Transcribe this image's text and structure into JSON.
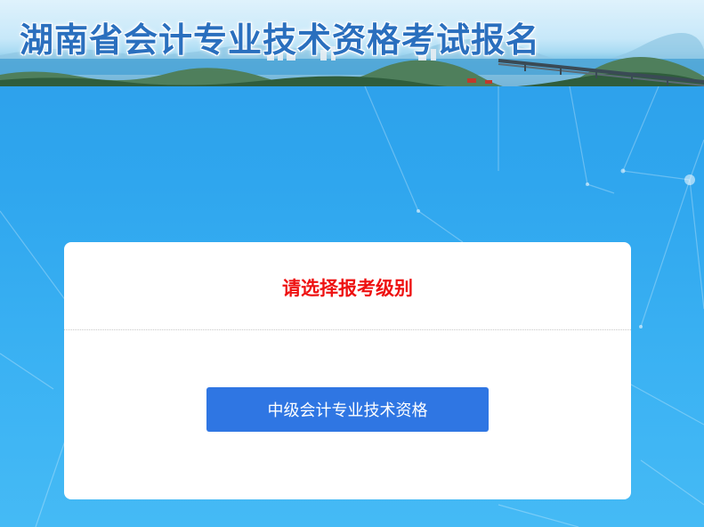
{
  "banner": {
    "title": "湖南省会计专业技术资格考试报名"
  },
  "card": {
    "title": "请选择报考级别",
    "button_label": "中级会计专业技术资格"
  },
  "colors": {
    "background": "#2fa6ee",
    "card_title": "#ee1111",
    "button": "#2f76e3",
    "banner_title": "#2a6fbe"
  }
}
